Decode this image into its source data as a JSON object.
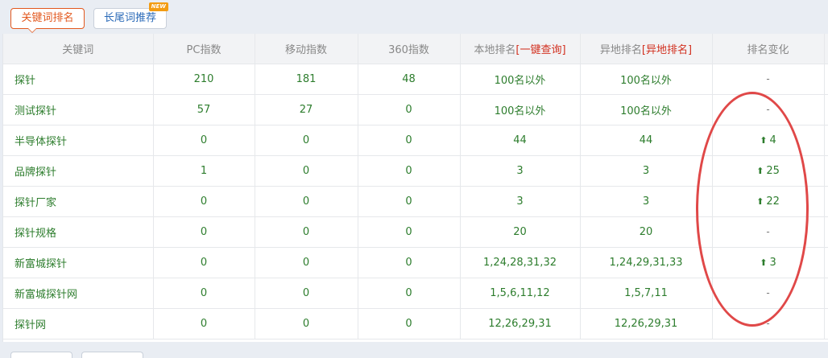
{
  "tabs": [
    {
      "label": "关键词排名",
      "active": true
    },
    {
      "label": "长尾词推荐",
      "badge": "NEW",
      "active": false
    }
  ],
  "table": {
    "headers": {
      "keyword": "关键词",
      "pc_index": "PC指数",
      "mobile_index": "移动指数",
      "index_360": "360指数",
      "local_rank": "本地排名",
      "local_rank_link": "[一键查询]",
      "remote_rank": "异地排名",
      "remote_rank_link": "[异地排名]",
      "rank_change": "排名变化"
    },
    "rows": [
      {
        "keyword": "探针",
        "pc": "210",
        "mobile": "181",
        "i360": "48",
        "local": "100名以外",
        "remote": "100名以外",
        "change": "-"
      },
      {
        "keyword": "测试探针",
        "pc": "57",
        "mobile": "27",
        "i360": "0",
        "local": "100名以外",
        "remote": "100名以外",
        "change": "-"
      },
      {
        "keyword": "半导体探针",
        "pc": "0",
        "mobile": "0",
        "i360": "0",
        "local": "44",
        "remote": "44",
        "change": "4",
        "up": true
      },
      {
        "keyword": "品牌探针",
        "pc": "1",
        "mobile": "0",
        "i360": "0",
        "local": "3",
        "remote": "3",
        "change": "25",
        "up": true
      },
      {
        "keyword": "探针厂家",
        "pc": "0",
        "mobile": "0",
        "i360": "0",
        "local": "3",
        "remote": "3",
        "change": "22",
        "up": true
      },
      {
        "keyword": "探针规格",
        "pc": "0",
        "mobile": "0",
        "i360": "0",
        "local": "20",
        "remote": "20",
        "change": "-"
      },
      {
        "keyword": "新富城探针",
        "pc": "0",
        "mobile": "0",
        "i360": "0",
        "local": "1,24,28,31,32",
        "remote": "1,24,29,31,33",
        "change": "3",
        "up": true
      },
      {
        "keyword": "新富城探针网",
        "pc": "0",
        "mobile": "0",
        "i360": "0",
        "local": "1,5,6,11,12",
        "remote": "1,5,7,11",
        "change": "-"
      },
      {
        "keyword": "探针网",
        "pc": "0",
        "mobile": "0",
        "i360": "0",
        "local": "12,26,29,31",
        "remote": "12,26,29,31",
        "change": "-"
      }
    ]
  },
  "colors": {
    "accent": "#e2581e",
    "link_blue": "#2a6ab8",
    "value_green": "#2d7d2d",
    "header_red": "#d2301f",
    "annotation_red": "#e04848"
  }
}
